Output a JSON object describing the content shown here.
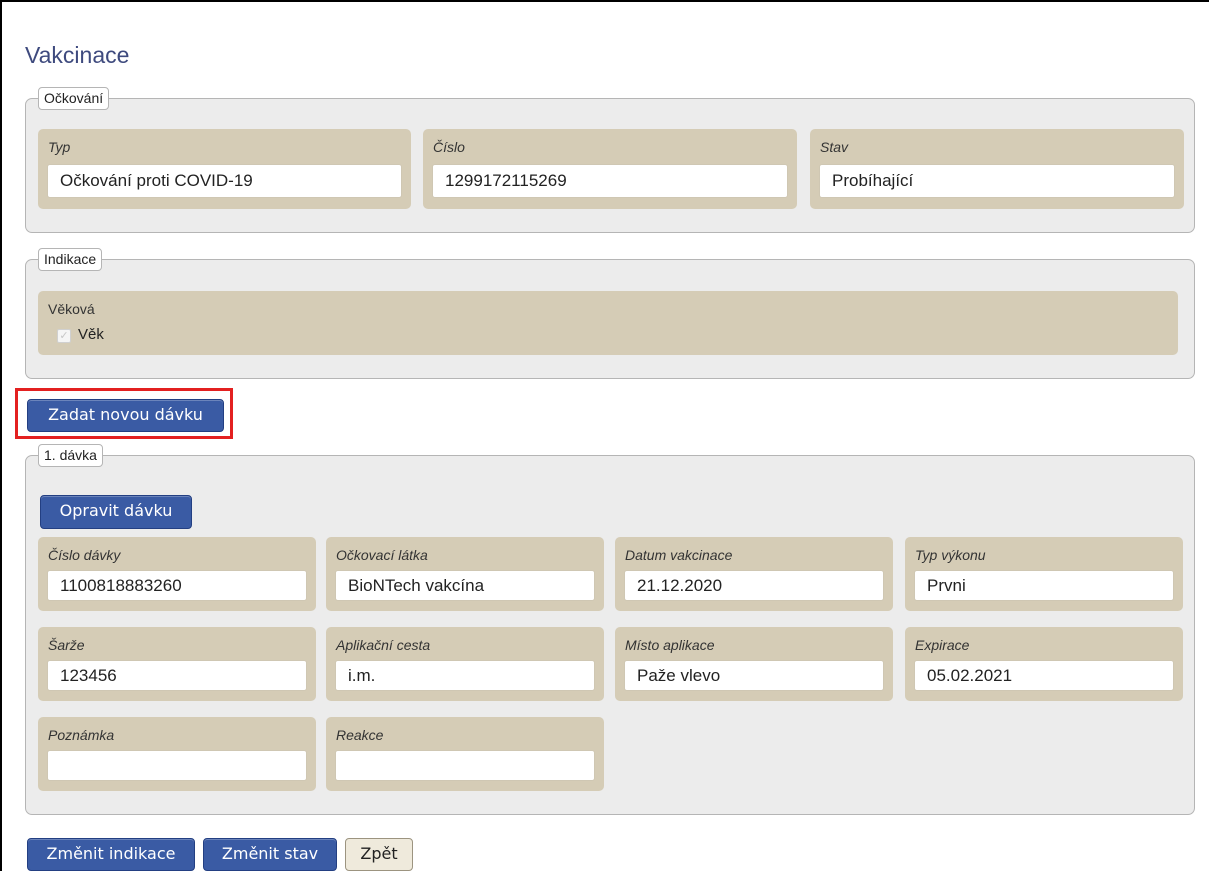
{
  "page": {
    "title": "Vakcinace"
  },
  "ockovani": {
    "legend": "Očkování",
    "fields": [
      {
        "label": "Typ",
        "value": "Očkování proti COVID-19"
      },
      {
        "label": "Číslo",
        "value": "1299172115269"
      },
      {
        "label": "Stav",
        "value": "Probíhající"
      }
    ]
  },
  "indikace": {
    "legend": "Indikace",
    "group_label": "Věková",
    "checkbox_label": "Věk",
    "checkbox_checked": true
  },
  "actions": {
    "new_dose": "Zadat novou dávku",
    "change_indication": "Změnit indikace",
    "change_state": "Změnit stav",
    "back": "Zpět"
  },
  "davka": {
    "legend": "1. dávka",
    "edit_button": "Opravit dávku",
    "fields": [
      {
        "label": "Číslo dávky",
        "value": "1100818883260"
      },
      {
        "label": "Očkovací látka",
        "value": "BioNTech vakcína"
      },
      {
        "label": "Datum vakcinace",
        "value": "21.12.2020"
      },
      {
        "label": "Typ výkonu",
        "value": "Prvni"
      },
      {
        "label": "Šarže",
        "value": "123456"
      },
      {
        "label": "Aplikační cesta",
        "value": "i.m."
      },
      {
        "label": "Místo aplikace",
        "value": "Paže vlevo"
      },
      {
        "label": "Expirace",
        "value": "05.02.2021"
      },
      {
        "label": "Poznámka",
        "value": ""
      },
      {
        "label": "Reakce",
        "value": ""
      }
    ]
  },
  "colors": {
    "title": "#3e4a7e",
    "card_background": "#d5ccb6",
    "primary_button": "#3a5ba4",
    "highlight": "#e32020"
  }
}
